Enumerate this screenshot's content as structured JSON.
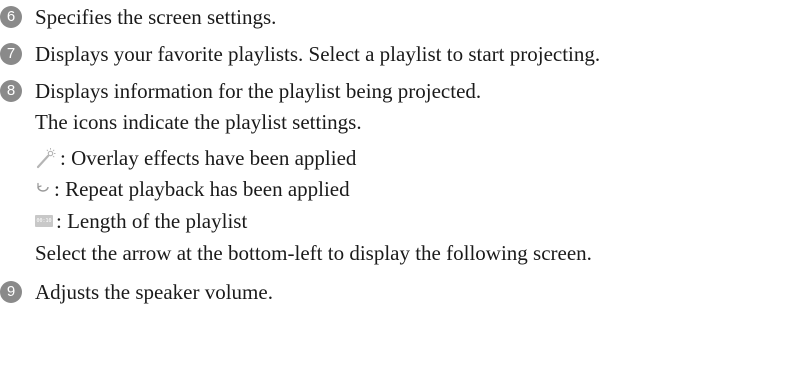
{
  "items": [
    {
      "number": "6",
      "text": "Specifies the screen settings."
    },
    {
      "number": "7",
      "text": "Displays your favorite playlists. Select a playlist to start projecting."
    },
    {
      "number": "8",
      "text": "Displays information for the playlist being projected."
    },
    {
      "number": "9",
      "text": "Adjusts the speaker volume."
    }
  ],
  "item8_details": {
    "intro": "The icons indicate the playlist settings.",
    "icons": [
      {
        "icon": "overlay-effects-icon",
        "label": ": Overlay effects have been applied"
      },
      {
        "icon": "repeat-playback-icon",
        "label": ": Repeat playback has been applied"
      },
      {
        "icon": "playlist-length-icon",
        "icon_text": "00:10",
        "label": ": Length of the playlist"
      }
    ],
    "outro": "Select the arrow at the bottom-left to display the following screen."
  },
  "colors": {
    "number_badge": "#8a8a8a",
    "icon_gray": "#b5b5b5",
    "text": "#1a1a1a"
  }
}
